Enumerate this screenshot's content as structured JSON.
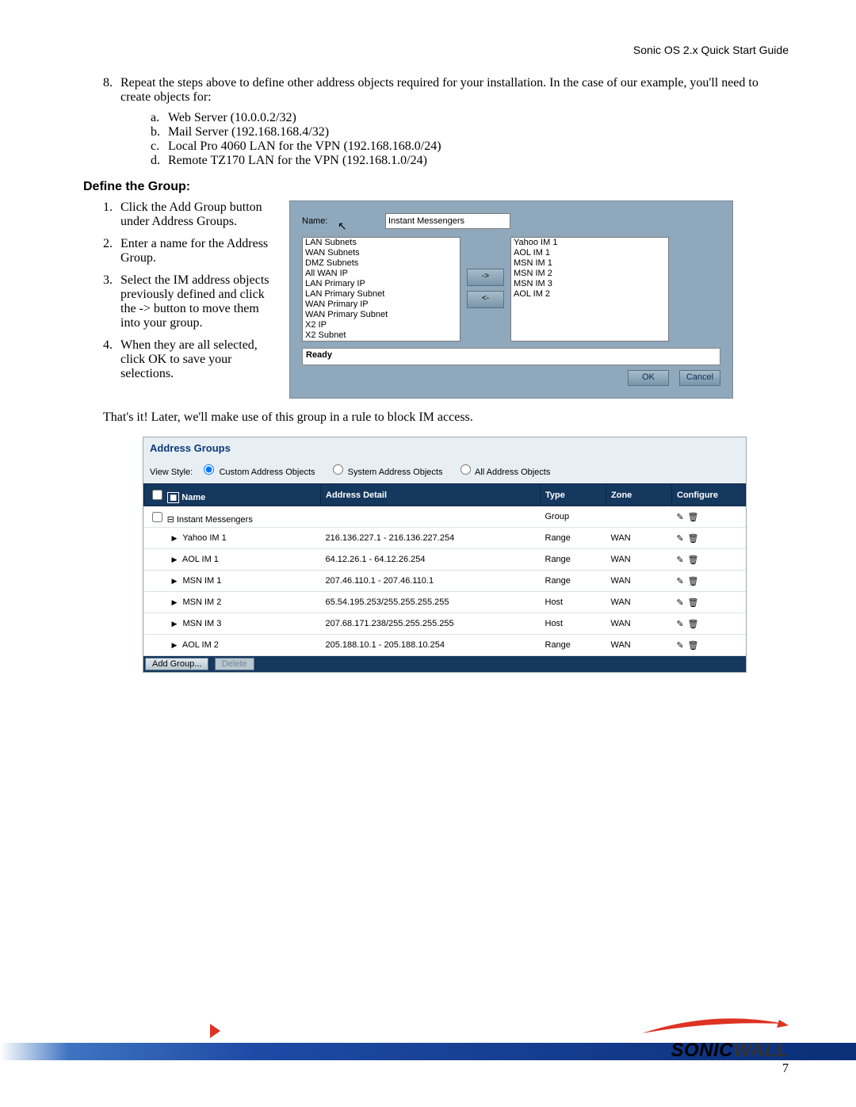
{
  "header_right": "Sonic OS 2.x Quick Start Guide",
  "step8": {
    "marker": "8.",
    "text": "Repeat the steps above to define other address objects required for your installation. In the case of our example, you'll need to create objects for:",
    "sub": [
      {
        "m": "a.",
        "t": "Web Server (10.0.0.2/32)"
      },
      {
        "m": "b.",
        "t": "Mail Server (192.168.168.4/32)"
      },
      {
        "m": "c.",
        "t": "Local Pro 4060 LAN for the VPN (192.168.168.0/24)"
      },
      {
        "m": "d.",
        "t": "Remote TZ170 LAN for the VPN (192.168.1.0/24)"
      }
    ]
  },
  "section_heading": "Define the Group:",
  "steps": [
    {
      "m": "1.",
      "t": "Click the Add Group button under Address Groups."
    },
    {
      "m": "2.",
      "t": "Enter a name for the Address Group."
    },
    {
      "m": "3.",
      "t": "Select the IM address objects previously defined and click the -> button to move them into your group."
    },
    {
      "m": "4.",
      "t": "When they are all selected, click OK to save your selections."
    }
  ],
  "dialog": {
    "name_label": "Name:",
    "name_value": "Instant Messengers",
    "available": [
      "LAN Subnets",
      "WAN Subnets",
      "DMZ Subnets",
      "All WAN IP",
      "LAN Primary IP",
      "LAN Primary Subnet",
      "WAN Primary IP",
      "WAN Primary Subnet",
      "X2 IP",
      "X2 Subnet"
    ],
    "selected": [
      "Yahoo IM 1",
      "AOL IM 1",
      "MSN IM 1",
      "MSN IM 2",
      "MSN IM 3",
      "AOL IM 2"
    ],
    "arrow_right": "->",
    "arrow_left": "<-",
    "status": "Ready",
    "ok": "OK",
    "cancel": "Cancel"
  },
  "closing_para": "That's it! Later, we'll make use of this group in a rule to block IM access.",
  "groups": {
    "title": "Address Groups",
    "view_label": "View Style:",
    "view_opts": [
      "Custom Address Objects",
      "System Address Objects",
      "All Address Objects"
    ],
    "cols": {
      "name": "Name",
      "detail": "Address Detail",
      "type": "Type",
      "zone": "Zone",
      "configure": "Configure"
    },
    "parent": {
      "name": "Instant Messengers",
      "detail": "",
      "type": "Group",
      "zone": ""
    },
    "rows": [
      {
        "name": "Yahoo IM 1",
        "detail": "216.136.227.1 - 216.136.227.254",
        "type": "Range",
        "zone": "WAN"
      },
      {
        "name": "AOL IM 1",
        "detail": "64.12.26.1 - 64.12.26.254",
        "type": "Range",
        "zone": "WAN"
      },
      {
        "name": "MSN IM 1",
        "detail": "207.46.110.1 - 207.46.110.1",
        "type": "Range",
        "zone": "WAN"
      },
      {
        "name": "MSN IM 2",
        "detail": "65.54.195.253/255.255.255.255",
        "type": "Host",
        "zone": "WAN"
      },
      {
        "name": "MSN IM 3",
        "detail": "207.68.171.238/255.255.255.255",
        "type": "Host",
        "zone": "WAN"
      },
      {
        "name": "AOL IM 2",
        "detail": "205.188.10.1 - 205.188.10.254",
        "type": "Range",
        "zone": "WAN"
      }
    ],
    "footer": {
      "add": "Add Group...",
      "delete": "Delete"
    }
  },
  "logo": {
    "brand1": "SONIC",
    "brand2": "WALL"
  },
  "page_number": "7"
}
